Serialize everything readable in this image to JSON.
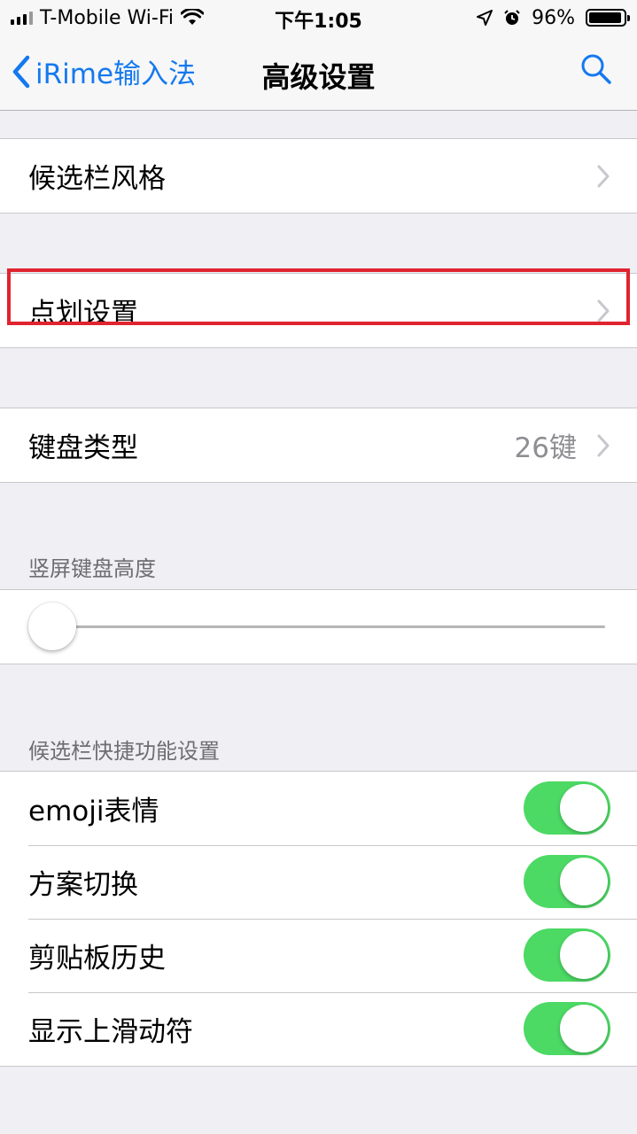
{
  "status_bar": {
    "carrier": "T-Mobile Wi-Fi",
    "time": "下午1:05",
    "battery": "96%",
    "battery_level": 0.96
  },
  "nav": {
    "back_label": "iRime输入法",
    "title": "高级设置"
  },
  "rows": {
    "candidate_style": "候选栏风格",
    "stroke_settings": "点划设置",
    "keyboard_type": {
      "label": "键盘类型",
      "value": "26键"
    }
  },
  "keyboard_height": {
    "header": "竖屏键盘高度",
    "level": 0.0
  },
  "shortcuts": {
    "header": "候选栏快捷功能设置",
    "items": [
      {
        "label": "emoji表情",
        "on": true
      },
      {
        "label": "方案切换",
        "on": true
      },
      {
        "label": "剪贴板历史",
        "on": true
      },
      {
        "label": "显示上滑动符",
        "on": true
      }
    ]
  },
  "colors": {
    "accent": "#1479ef",
    "toggle_on": "#4cd964",
    "highlight": "#e0242f"
  }
}
